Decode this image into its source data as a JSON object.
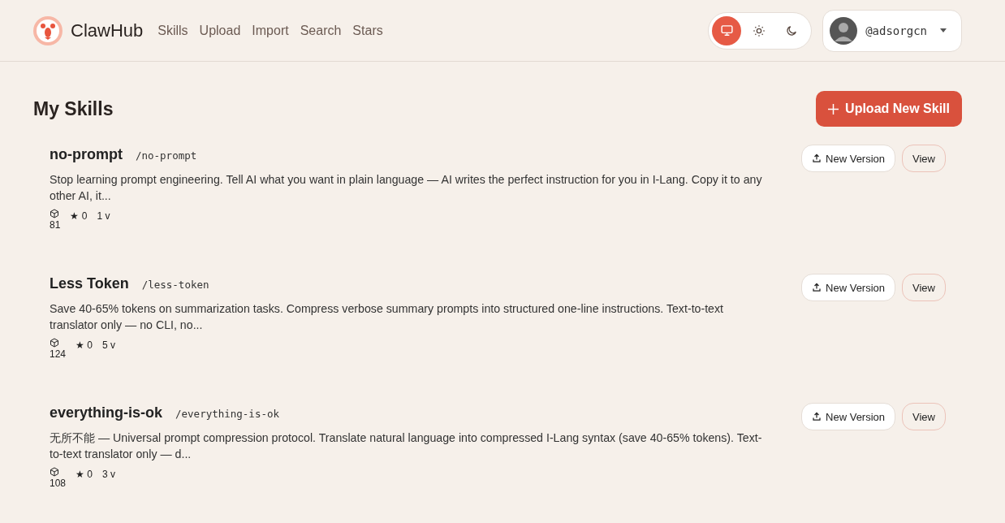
{
  "header": {
    "brand": "ClawHub",
    "nav": [
      "Skills",
      "Upload",
      "Import",
      "Search",
      "Stars"
    ],
    "theme_options": [
      {
        "kind": "system",
        "selected": true
      },
      {
        "kind": "light",
        "selected": false
      },
      {
        "kind": "dark",
        "selected": false
      }
    ],
    "user": {
      "handle": "@adsorgcn"
    }
  },
  "page": {
    "title": "My Skills",
    "upload_button": "Upload New Skill"
  },
  "skills": [
    {
      "name": "no-prompt",
      "slug": "/no-prompt",
      "description": "Stop learning prompt engineering. Tell AI what you want in plain language — AI writes the perfect instruction for you in I-Lang. Copy it to any other AI, it...",
      "downloads": "81",
      "stars": "★ 0",
      "versions": "1 v",
      "new_version": "New Version",
      "view": "View"
    },
    {
      "name": "Less Token",
      "slug": "/less-token",
      "description": "Save 40-65% tokens on summarization tasks. Compress verbose summary prompts into structured one-line instructions. Text-to-text translator only — no CLI, no...",
      "downloads": "124",
      "stars": "★ 0",
      "versions": "5 v",
      "new_version": "New Version",
      "view": "View"
    },
    {
      "name": "everything-is-ok",
      "slug": "/everything-is-ok",
      "description": "无所不能 — Universal prompt compression protocol. Translate natural language into compressed I-Lang syntax (save 40-65% tokens). Text-to-text translator only — d...",
      "downloads": "108",
      "stars": "★ 0",
      "versions": "3 v",
      "new_version": "New Version",
      "view": "View"
    }
  ]
}
